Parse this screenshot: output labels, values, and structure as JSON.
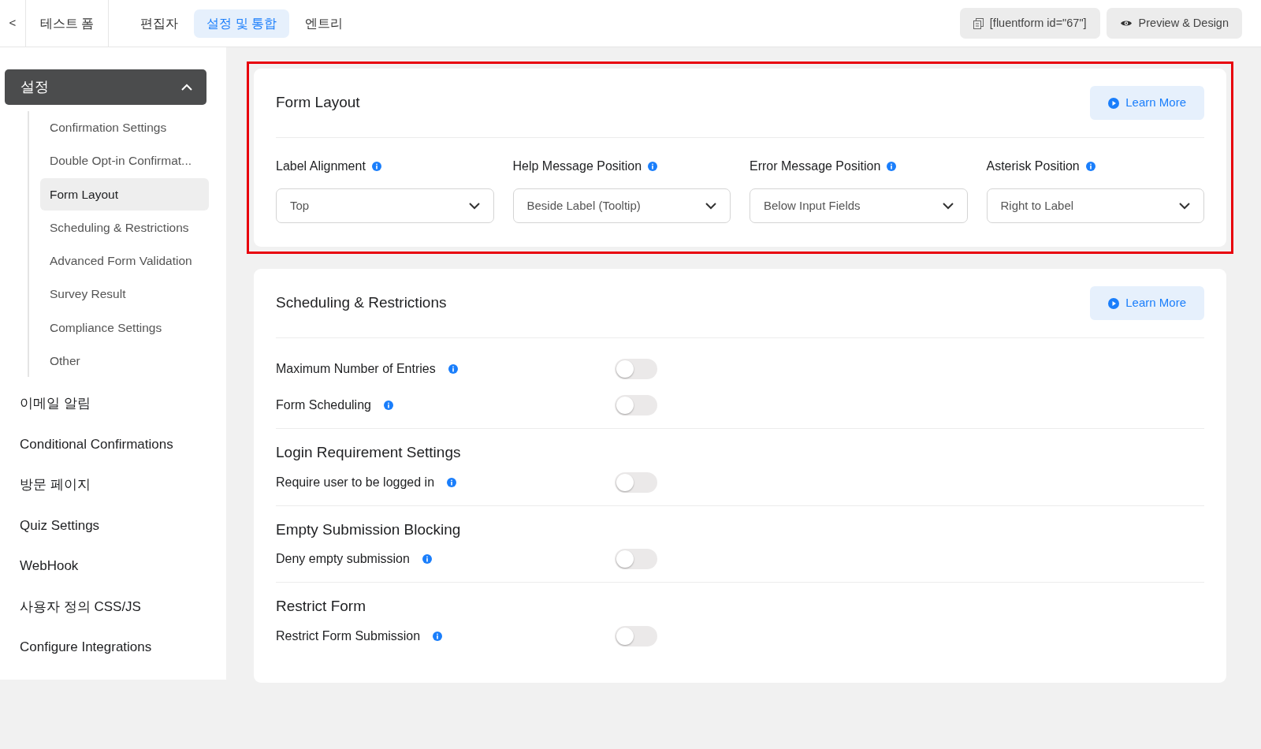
{
  "top_bar": {
    "back": "<",
    "form_title": "테스트 폼",
    "tabs": [
      {
        "label": "편집자",
        "selected": false
      },
      {
        "label": "설정 및 통합",
        "selected": true
      },
      {
        "label": "엔트리",
        "selected": false
      }
    ],
    "shortcode": "[fluentform id=\"67\"]",
    "preview": "Preview & Design"
  },
  "sidebar": {
    "group": {
      "label": "설정",
      "expanded": true,
      "children": [
        {
          "label": "Confirmation Settings",
          "selected": false
        },
        {
          "label": "Double Opt-in Confirmat...",
          "selected": false
        },
        {
          "label": "Form Layout",
          "selected": true
        },
        {
          "label": "Scheduling & Restrictions",
          "selected": false
        },
        {
          "label": "Advanced Form Validation",
          "selected": false
        },
        {
          "label": "Survey Result",
          "selected": false
        },
        {
          "label": "Compliance Settings",
          "selected": false
        },
        {
          "label": "Other",
          "selected": false
        }
      ]
    },
    "items": [
      "이메일 알림",
      "Conditional Confirmations",
      "방문 페이지",
      "Quiz Settings",
      "WebHook",
      "사용자 정의 CSS/JS",
      "Configure Integrations"
    ]
  },
  "sections": [
    {
      "kind": "selects",
      "title": "Form Layout",
      "learn_more": "Learn More",
      "highlighted": true,
      "fields": [
        {
          "label": "Label Alignment",
          "value": "Top"
        },
        {
          "label": "Help Message Position",
          "value": "Beside Label (Tooltip)"
        },
        {
          "label": "Error Message Position",
          "value": "Below Input Fields"
        },
        {
          "label": "Asterisk Position",
          "value": "Right to Label"
        }
      ]
    },
    {
      "kind": "toggles",
      "title": "Scheduling & Restrictions",
      "learn_more": "Learn More",
      "groups": [
        {
          "toggles": [
            {
              "label": "Maximum Number of Entries",
              "on": false
            },
            {
              "label": "Form Scheduling",
              "on": false
            }
          ]
        },
        {
          "heading": "Login Requirement Settings",
          "toggles": [
            {
              "label": "Require user to be logged in",
              "on": false
            }
          ]
        },
        {
          "heading": "Empty Submission Blocking",
          "toggles": [
            {
              "label": "Deny empty submission",
              "on": false
            }
          ]
        },
        {
          "heading": "Restrict Form",
          "toggles": [
            {
              "label": "Restrict Form Submission",
              "on": false
            }
          ]
        }
      ]
    }
  ]
}
